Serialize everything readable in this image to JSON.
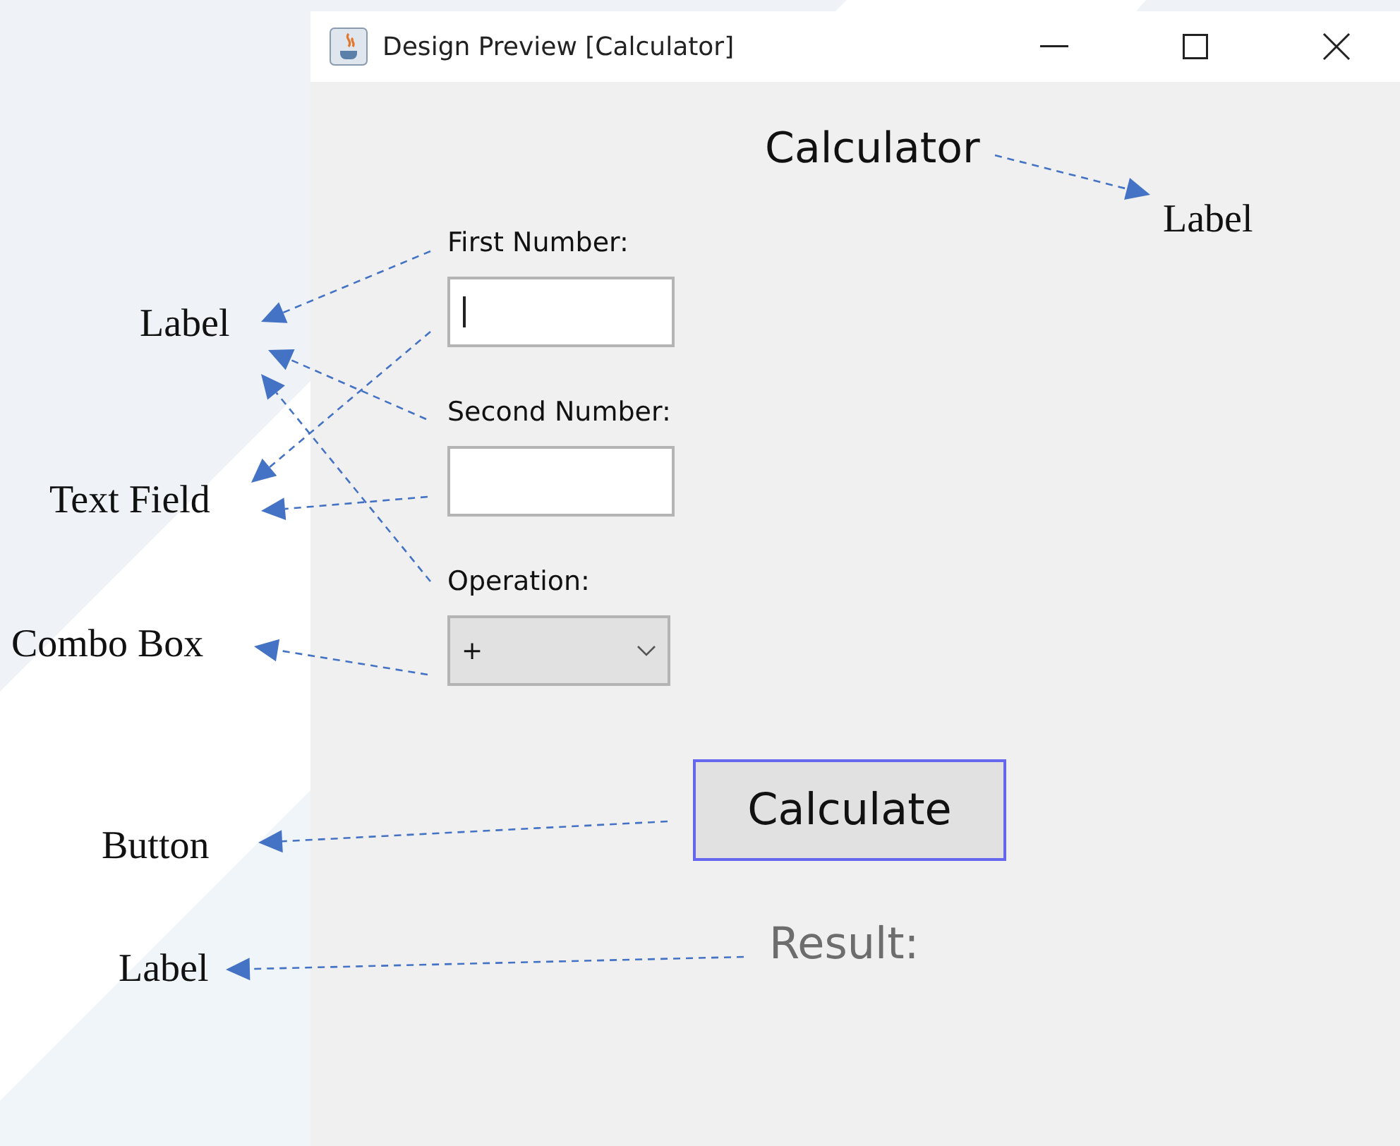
{
  "window": {
    "title": "Design Preview [Calculator]"
  },
  "form": {
    "heading": "Calculator",
    "fields": [
      {
        "kind": "text",
        "label": "First Number:",
        "focused": true
      },
      {
        "kind": "text",
        "label": "Second Number:",
        "focused": false
      },
      {
        "kind": "combo",
        "label": "Operation:",
        "value": "+"
      }
    ],
    "button": "Calculate",
    "result": "Result:"
  },
  "callouts": [
    {
      "text": "Label"
    },
    {
      "text": "Label"
    },
    {
      "text": "Text Field"
    },
    {
      "text": "Combo Box"
    },
    {
      "text": "Button"
    },
    {
      "text": "Label"
    }
  ]
}
